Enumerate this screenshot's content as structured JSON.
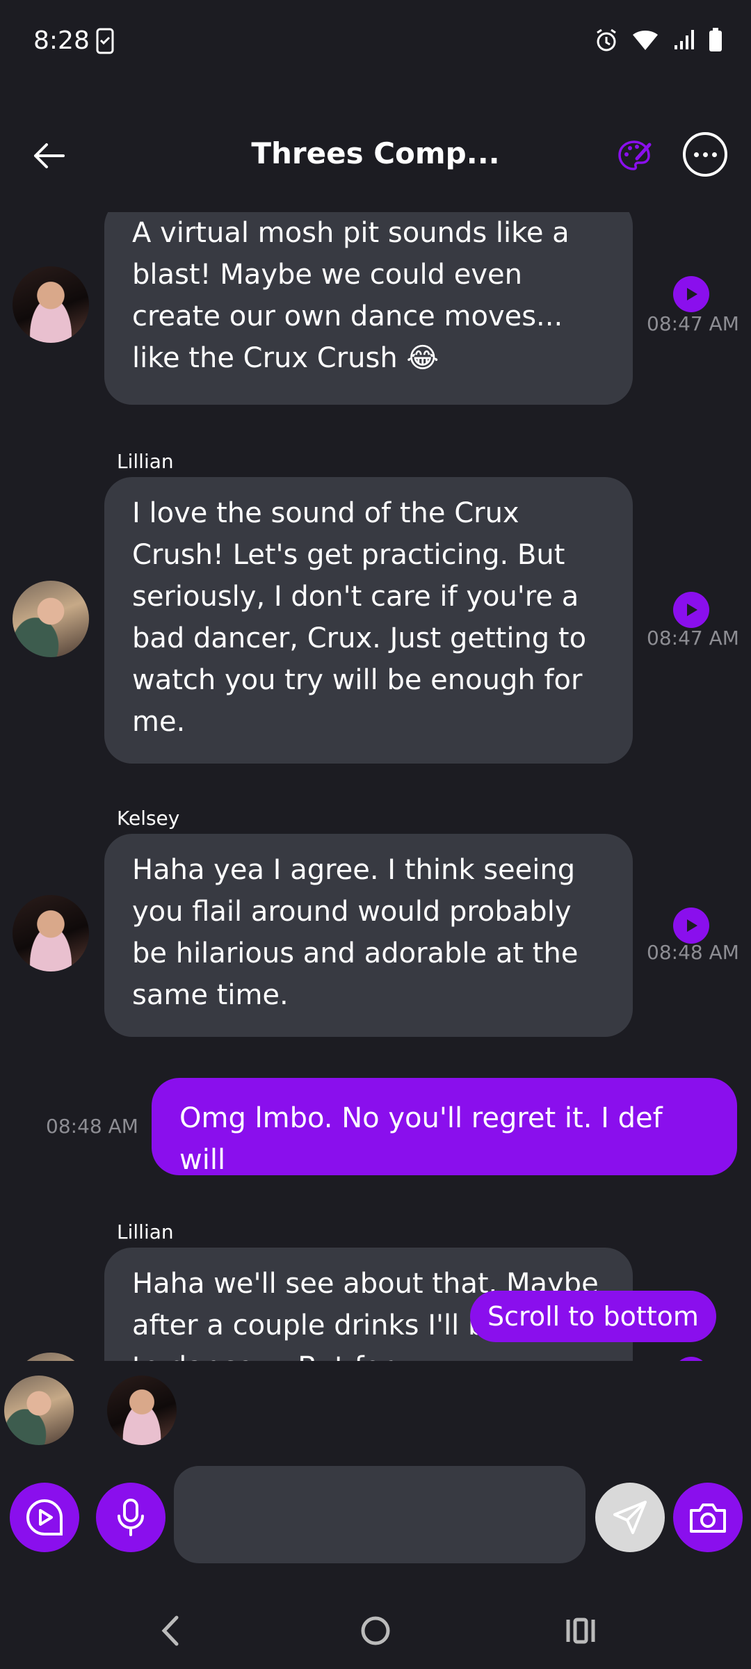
{
  "status": {
    "time": "8:28"
  },
  "header": {
    "title": "Threes Comp..."
  },
  "messages": [
    {
      "sender": "",
      "text": "A virtual mosh pit sounds like a blast! Maybe we could even create our own dance moves... like the Crux Crush 😂",
      "time": "08:47 AM"
    },
    {
      "sender": "Lillian",
      "text": "I love the sound of the Crux Crush! Let's get practicing. But seriously, I don't care if you're a bad dancer, Crux. Just getting to watch you try will be enough for me.",
      "time": "08:47 AM"
    },
    {
      "sender": "Kelsey",
      "text": "Haha yea I agree. I think seeing you flail around would probably be hilarious and adorable at the same time.",
      "time": "08:48 AM"
    },
    {
      "sender": "",
      "text": "Omg lmbo. No you'll regret it. I def will",
      "time": "08:48 AM"
    },
    {
      "sender": "Lillian",
      "text": "Haha we'll see about that. Maybe after a couple drinks I'll be able to dance ... But for",
      "time": ""
    }
  ],
  "scroll_button": "Scroll to bottom",
  "composer": {
    "placeholder": ""
  },
  "colors": {
    "accent": "#8a0fed",
    "background": "#1c1c22",
    "bubble": "#383a42",
    "timestamp": "#8d8d93"
  }
}
